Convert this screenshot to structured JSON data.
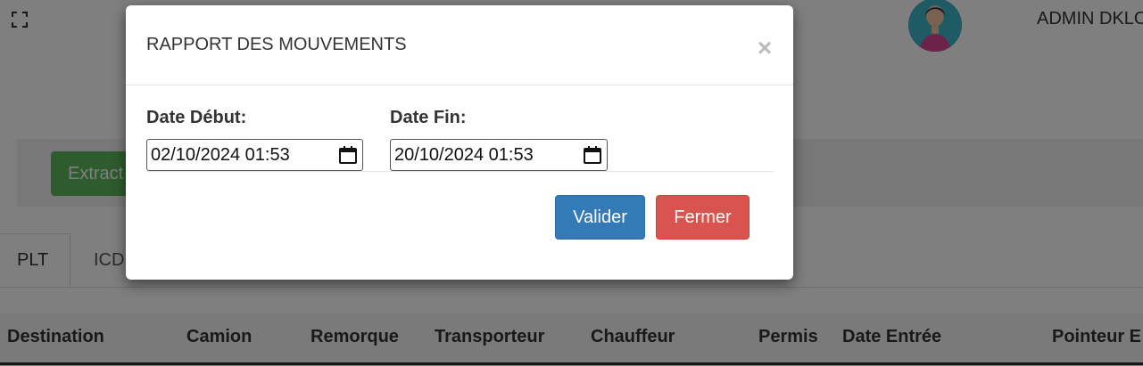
{
  "header": {
    "expand_icon": "expand-icon",
    "user_name": "ADMIN DKLO",
    "avatar_icon": "user-avatar"
  },
  "actions": {
    "extract_label": "Extract"
  },
  "tabs": [
    {
      "label": "PLT",
      "active": true
    },
    {
      "label": "ICD",
      "active": false
    }
  ],
  "table": {
    "columns": [
      "Destination",
      "Camion",
      "Remorque",
      "Transporteur",
      "Chauffeur",
      "Permis",
      "Date Entrée",
      "Pointeur E"
    ]
  },
  "modal": {
    "title": "RAPPORT DES MOUVEMENTS",
    "close_symbol": "×",
    "start_label": "Date Début:",
    "start_value": "02/10/2024 01:53",
    "end_label": "Date Fin:",
    "end_value": "20/10/2024 01:53",
    "calendar_icon": "calendar-icon",
    "validate_label": "Valider",
    "close_label": "Fermer"
  },
  "colors": {
    "primary": "#337ab7",
    "danger": "#d9534f",
    "success": "#5cb85c",
    "overlay": "rgba(0,0,0,0.5)"
  }
}
